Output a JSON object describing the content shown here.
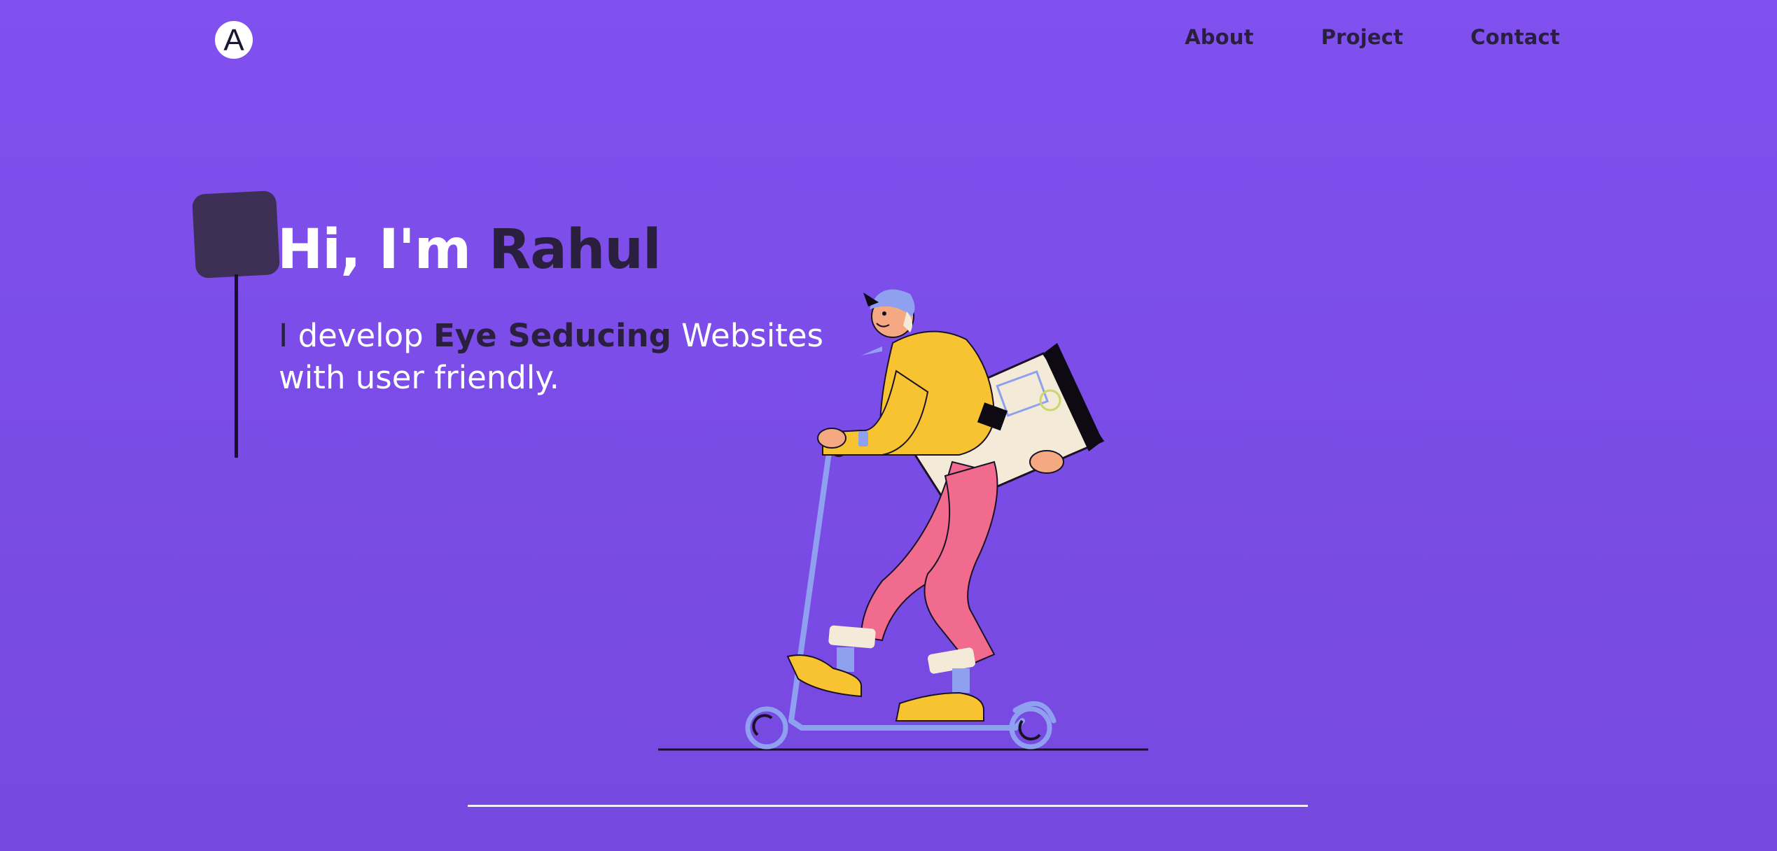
{
  "logo": {
    "letter": "A"
  },
  "nav": {
    "items": [
      {
        "label": "About"
      },
      {
        "label": "Project"
      },
      {
        "label": "Contact"
      }
    ]
  },
  "hero": {
    "title_light": "Hi, I'm",
    "title_dark": "Rahul",
    "subtitle_first": "I",
    "subtitle_pre": " develop ",
    "subtitle_highlight": "Eye Seducing",
    "subtitle_post": " Websites with user friendly."
  },
  "colors": {
    "background": "#7b4de8",
    "dark_text": "#2a1f3f",
    "accent_block": "#3d2f55",
    "light_text": "#ffffff"
  },
  "illustration": {
    "icon": "person-on-scooter-illustration"
  }
}
